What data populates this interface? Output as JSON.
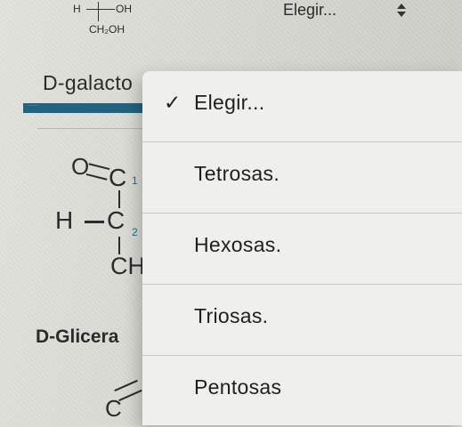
{
  "background": {
    "fischer_top": {
      "h": "H",
      "oh": "OH",
      "ch2oh": "CH₂OH"
    },
    "galacto_label": "D-galacto",
    "glyceraldehyde": {
      "o": "O",
      "c1": "C",
      "sub1": "1",
      "h": "H",
      "c2": "C",
      "sub2": "2",
      "ch": "CH",
      "label": "D-Glicera"
    },
    "bottom_c": "C"
  },
  "select": {
    "value": "Elegir..."
  },
  "dropdown": {
    "options": [
      {
        "label": "Elegir...",
        "checked": true,
        "check_glyph": "✓"
      },
      {
        "label": "Tetrosas.",
        "checked": false
      },
      {
        "label": "Hexosas.",
        "checked": false
      },
      {
        "label": "Triosas.",
        "checked": false
      },
      {
        "label": "Pentosas",
        "checked": false
      }
    ]
  },
  "colors": {
    "accent_bar": "#24637f",
    "menu_bg": "#efefec"
  }
}
